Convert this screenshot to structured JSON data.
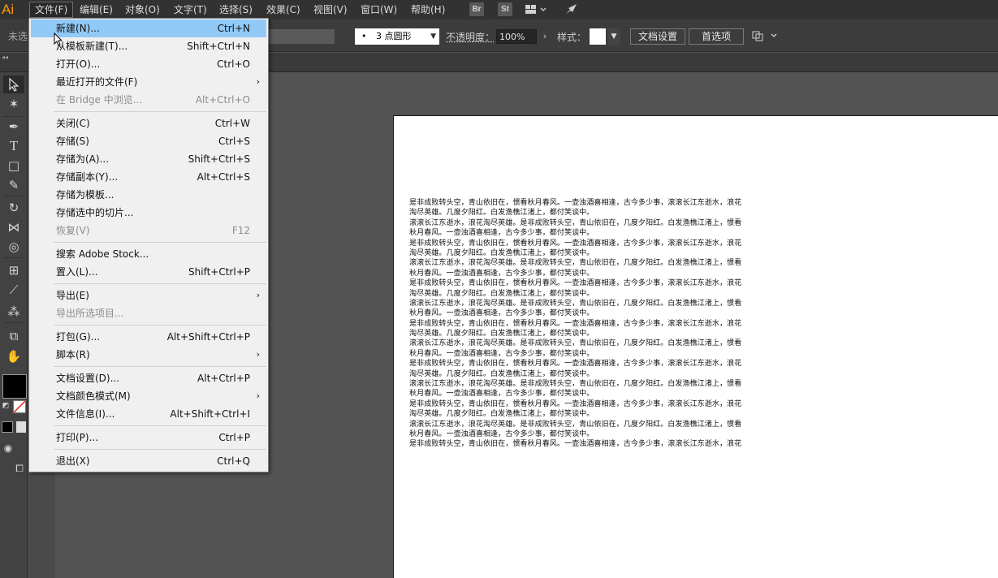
{
  "app": {
    "logo": "Ai"
  },
  "menubar": {
    "items": [
      "文件(F)",
      "编辑(E)",
      "对象(O)",
      "文字(T)",
      "选择(S)",
      "效果(C)",
      "视图(V)",
      "窗口(W)",
      "帮助(H)"
    ],
    "icons": {
      "bridge": "Br",
      "stock": "St"
    }
  },
  "controlbar": {
    "left_label": "未选",
    "brush": "3 点圆形",
    "brush_dot": "•",
    "opacity_label": "不透明度：",
    "opacity_value": "100%",
    "style_label": "样式：",
    "doc_setup": "文档设置",
    "preferences": "首选项"
  },
  "file_menu": {
    "items": [
      {
        "label": "新建(N)...",
        "shortcut": "Ctrl+N"
      },
      {
        "label": "从模板新建(T)...",
        "shortcut": "Shift+Ctrl+N"
      },
      {
        "label": "打开(O)...",
        "shortcut": "Ctrl+O"
      },
      {
        "label": "最近打开的文件(F)",
        "shortcut": "",
        "submenu": "›"
      },
      {
        "label": "在 Bridge 中浏览...",
        "shortcut": "Alt+Ctrl+O"
      },
      {
        "label": "关闭(C)",
        "shortcut": "Ctrl+W"
      },
      {
        "label": "存储(S)",
        "shortcut": "Ctrl+S"
      },
      {
        "label": "存储为(A)...",
        "shortcut": "Shift+Ctrl+S"
      },
      {
        "label": "存储副本(Y)...",
        "shortcut": "Alt+Ctrl+S"
      },
      {
        "label": "存储为模板...",
        "shortcut": ""
      },
      {
        "label": "存储选中的切片...",
        "shortcut": ""
      },
      {
        "label": "恢复(V)",
        "shortcut": "F12"
      },
      {
        "label": "搜索 Adobe Stock...",
        "shortcut": ""
      },
      {
        "label": "置入(L)...",
        "shortcut": "Shift+Ctrl+P"
      },
      {
        "label": "导出(E)",
        "shortcut": "",
        "submenu": "›"
      },
      {
        "label": "导出所选项目...",
        "shortcut": ""
      },
      {
        "label": "打包(G)...",
        "shortcut": "Alt+Shift+Ctrl+P"
      },
      {
        "label": "脚本(R)",
        "shortcut": "",
        "submenu": "›"
      },
      {
        "label": "文档设置(D)...",
        "shortcut": "Alt+Ctrl+P"
      },
      {
        "label": "文档颜色模式(M)",
        "shortcut": "",
        "submenu": "›"
      },
      {
        "label": "文件信息(I)...",
        "shortcut": "Alt+Shift+Ctrl+I"
      },
      {
        "label": "打印(P)...",
        "shortcut": "Ctrl+P"
      },
      {
        "label": "退出(X)",
        "shortcut": "Ctrl+Q"
      }
    ]
  },
  "document": {
    "lines": [
      "是非成败转头空，青山依旧在，惯看秋月春风。一壶浊酒喜相逢，古今多少事，滚滚长江东逝水，浪花",
      "淘尽英雄。几度夕阳红。白发渔樵江渚上，都付笑谈中。",
      "滚滚长江东逝水，浪花淘尽英雄。是非成败转头空，青山依旧在，几度夕阳红。白发渔樵江渚上，惯看",
      "秋月春风。一壶浊酒喜相逢，古今多少事，都付笑谈中。",
      "是非成败转头空，青山依旧在，惯看秋月春风。一壶浊酒喜相逢，古今多少事，滚滚长江东逝水，浪花",
      "淘尽英雄。几度夕阳红。白发渔樵江渚上，都付笑谈中。",
      "滚滚长江东逝水，浪花淘尽英雄。是非成败转头空，青山依旧在，几度夕阳红。白发渔樵江渚上，惯看",
      "秋月春风。一壶浊酒喜相逢，古今多少事，都付笑谈中。",
      "是非成败转头空，青山依旧在，惯看秋月春风。一壶浊酒喜相逢，古今多少事，滚滚长江东逝水，浪花",
      "淘尽英雄。几度夕阳红。白发渔樵江渚上，都付笑谈中。",
      "滚滚长江东逝水，浪花淘尽英雄。是非成败转头空，青山依旧在，几度夕阳红。白发渔樵江渚上，惯看",
      "秋月春风。一壶浊酒喜相逢，古今多少事，都付笑谈中。",
      "是非成败转头空，青山依旧在，惯看秋月春风。一壶浊酒喜相逢，古今多少事，滚滚长江东逝水，浪花",
      "淘尽英雄。几度夕阳红。白发渔樵江渚上，都付笑谈中。",
      "滚滚长江东逝水，浪花淘尽英雄。是非成败转头空，青山依旧在，几度夕阳红。白发渔樵江渚上，惯看",
      "秋月春风。一壶浊酒喜相逢，古今多少事，都付笑谈中。",
      "是非成败转头空，青山依旧在，惯看秋月春风。一壶浊酒喜相逢，古今多少事，滚滚长江东逝水，浪花",
      "淘尽英雄。几度夕阳红。白发渔樵江渚上，都付笑谈中。",
      "滚滚长江东逝水，浪花淘尽英雄。是非成败转头空，青山依旧在，几度夕阳红。白发渔樵江渚上，惯看",
      "秋月春风。一壶浊酒喜相逢，古今多少事，都付笑谈中。",
      "是非成败转头空，青山依旧在，惯看秋月春风。一壶浊酒喜相逢，古今多少事，滚滚长江东逝水，浪花",
      "淘尽英雄。几度夕阳红。白发渔樵江渚上，都付笑谈中。",
      "滚滚长江东逝水，浪花淘尽英雄。是非成败转头空，青山依旧在，几度夕阳红。白发渔樵江渚上，惯看",
      "秋月春风。一壶浊酒喜相逢，古今多少事，都付笑谈中。",
      "是非成败转头空，青山依旧在，惯看秋月春风。一壶浊酒喜相逢，古今多少事，滚滚长江东逝水，浪花"
    ]
  },
  "colors": {
    "accent": "#ff9a00",
    "highlight": "#91c9f7"
  }
}
